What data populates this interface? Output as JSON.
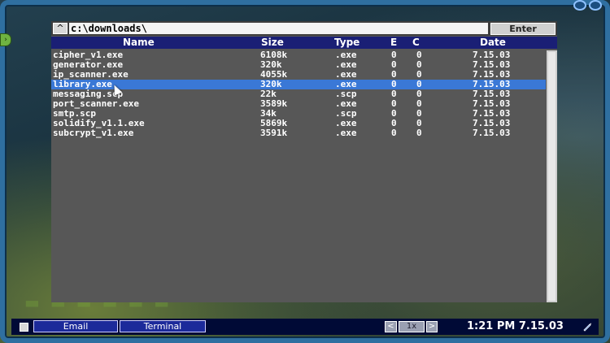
{
  "file_browser": {
    "up_button_label": "^",
    "path": "c:\\downloads\\",
    "enter_label": "Enter",
    "columns": {
      "name": "Name",
      "size": "Size",
      "type": "Type",
      "e": "E",
      "c": "C",
      "date": "Date"
    },
    "files": [
      {
        "name": "cipher_v1.exe",
        "size": "6108k",
        "type": ".exe",
        "e": "0",
        "c": "0",
        "date": "7.15.03"
      },
      {
        "name": "generator.exe",
        "size": "320k",
        "type": ".exe",
        "e": "0",
        "c": "0",
        "date": "7.15.03"
      },
      {
        "name": "ip_scanner.exe",
        "size": "4055k",
        "type": ".exe",
        "e": "0",
        "c": "0",
        "date": "7.15.03"
      },
      {
        "name": "library.exe",
        "size": "320k",
        "type": ".exe",
        "e": "0",
        "c": "0",
        "date": "7.15.03"
      },
      {
        "name": "messaging.scp",
        "size": "22k",
        "type": ".scp",
        "e": "0",
        "c": "0",
        "date": "7.15.03"
      },
      {
        "name": "port_scanner.exe",
        "size": "3589k",
        "type": ".exe",
        "e": "0",
        "c": "0",
        "date": "7.15.03"
      },
      {
        "name": "smtp.scp",
        "size": "34k",
        "type": ".scp",
        "e": "0",
        "c": "0",
        "date": "7.15.03"
      },
      {
        "name": "solidify_v1.1.exe",
        "size": "5869k",
        "type": ".exe",
        "e": "0",
        "c": "0",
        "date": "7.15.03"
      },
      {
        "name": "subcrypt_v1.exe",
        "size": "3591k",
        "type": ".exe",
        "e": "0",
        "c": "0",
        "date": "7.15.03"
      }
    ],
    "selected_file": "library.exe"
  },
  "taskbar": {
    "email_label": "Email",
    "terminal_label": "Terminal",
    "prev_label": "<",
    "zoom_label": "1x",
    "next_label": ">",
    "clock": "1:21 PM 7.15.03"
  },
  "colors": {
    "header_bg": "#1a1f75",
    "selected_row": "#3a78d6",
    "window_bg": "#575757",
    "taskbar_bg": "#000a36",
    "frame": "#2f6fa0"
  },
  "icons": [
    "close-icon",
    "minimize-icon",
    "side-panel-toggle-icon",
    "pen-icon",
    "cursor-pointer-icon"
  ]
}
